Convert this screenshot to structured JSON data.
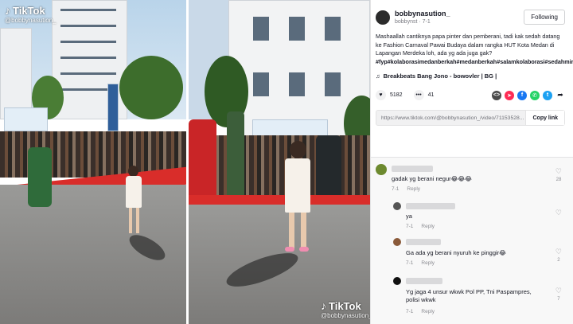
{
  "watermark": {
    "logo_left": "TikTok",
    "handle_left": "@bobbynasution_",
    "logo_right": "TikTok",
    "handle_right": "@bobbynasution_"
  },
  "post": {
    "author_name": "bobbynasution_",
    "author_meta": "bobbynst · 7-1",
    "follow_label": "Following",
    "caption_text": "Mashaallah cantiknya papa pinter dan pemberani, tadi kak sedah datang ke Fashion Carnaval Pawai Budaya dalam rangka HUT Kota Medan di Lapangan Merdeka loh, ada yg ada juga gak? ",
    "caption_tags": "#fyp#kolaborasimedanberkah#medanberkah#salamkolaborasi#sedahmirah",
    "music": "Breakbeats Bang Jono - bowovler | BG |",
    "likes": "5182",
    "comments_count": "41",
    "link_url": "https://www.tiktok.com/@bobbynasution_/video/71153528...",
    "copy_label": "Copy link"
  },
  "comments": [
    {
      "text": "gadak yg berani negur😂😂😂",
      "date": "7-1",
      "reply": "Reply",
      "likes": "28"
    },
    {
      "text": "ya",
      "date": "7-1",
      "reply": "Reply",
      "likes": ""
    },
    {
      "text": "Ga ada yg berani nyuruh ke pinggir😂",
      "date": "7-1",
      "reply": "Reply",
      "likes": "2"
    },
    {
      "text": "Yg jaga 4 unsur wkwk Pol PP, Tni Paspampres, polisi wkwk",
      "date": "7-1",
      "reply": "Reply",
      "likes": "7"
    }
  ],
  "colors": {
    "accent_red": "#fe2c55",
    "carpet_red": "#d92d2a",
    "share_code": "#4a4a4a",
    "share_red": "#fe2c55",
    "share_fb": "#1877f2",
    "share_wa": "#25d366",
    "share_tw": "#1da1f2"
  },
  "icons": {
    "heart": "heart-icon",
    "comment": "comment-icon",
    "music": "music-note-icon",
    "share": "share-arrow-icon"
  }
}
